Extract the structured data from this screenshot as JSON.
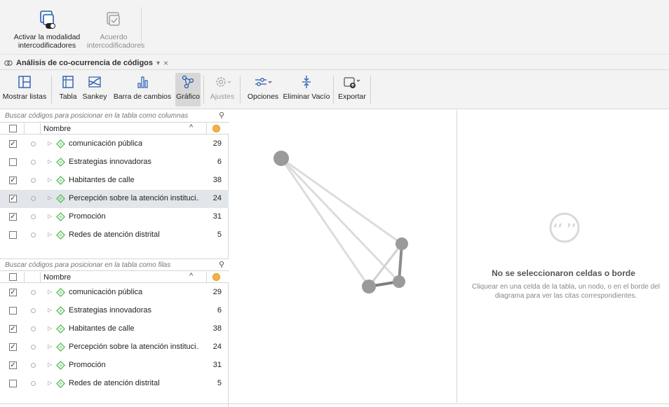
{
  "ribbon": {
    "activate_label_1": "Activar la modalidad",
    "activate_label_2": "intercodificadores",
    "agreement_label_1": "Acuerdo",
    "agreement_label_2": "intercodificadores"
  },
  "tab": {
    "title": "Análisis de co-ocurrencia de códigos",
    "dropdown": "▾",
    "close": "×"
  },
  "toolbar": {
    "show_lists": "Mostrar listas",
    "table": "Tabla",
    "sankey": "Sankey",
    "change_bar": "Barra de cambios",
    "graph": "Gráfico",
    "settings": "Ajustes",
    "options": "Opciones",
    "remove_empty": "Eliminar Vacío",
    "export": "Exportar"
  },
  "columns_list": {
    "search_placeholder": "Buscar códigos para posicionar en la tabla como columnas",
    "header_name": "Nombre",
    "items": [
      {
        "label": "comunicación pública",
        "count": "29",
        "checked": true
      },
      {
        "label": "Estrategias innovadoras",
        "count": "6",
        "checked": false
      },
      {
        "label": "Habitantes de calle",
        "count": "38",
        "checked": true
      },
      {
        "label": "Percepción sobre la atención instituci...",
        "count": "24",
        "checked": true
      },
      {
        "label": "Promoción",
        "count": "31",
        "checked": true
      },
      {
        "label": "Redes de atención distrital",
        "count": "5",
        "checked": false
      }
    ]
  },
  "rows_list": {
    "search_placeholder": "Buscar códigos para posicionar en la tabla como filas",
    "header_name": "Nombre",
    "items": [
      {
        "label": "comunicación pública",
        "count": "29",
        "checked": true
      },
      {
        "label": "Estrategias innovadoras",
        "count": "6",
        "checked": false
      },
      {
        "label": "Habitantes de calle",
        "count": "38",
        "checked": true
      },
      {
        "label": "Percepción sobre la atención instituci...",
        "count": "24",
        "checked": true
      },
      {
        "label": "Promoción",
        "count": "31",
        "checked": true
      },
      {
        "label": "Redes de atención distrital",
        "count": "5",
        "checked": false
      }
    ]
  },
  "empty_state": {
    "title": "No se seleccionaron celdas o borde",
    "description": "Cliquear en una celda de la tabla, un nodo, o en el borde del diagrama para ver las citas correspondientes."
  },
  "colors": {
    "node": "#9a9a9a",
    "edge_light": "#d8d8d8",
    "edge_dark": "#8a8a8a",
    "code_icon": "#5bbf5b",
    "selected_row": "#e2e6ea"
  }
}
